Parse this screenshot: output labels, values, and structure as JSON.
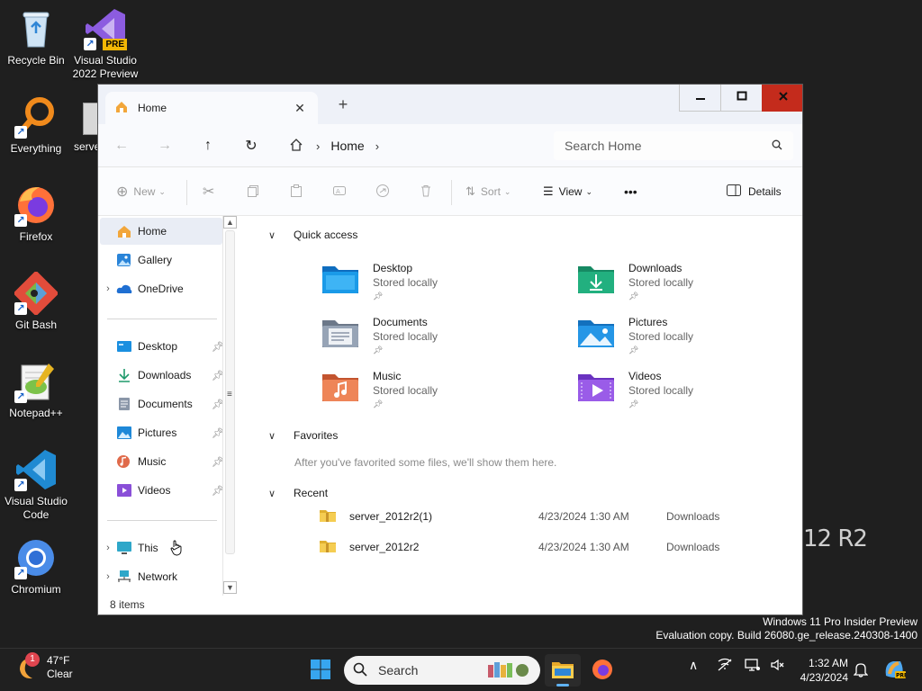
{
  "desktop": {
    "icons": [
      {
        "label": "Recycle Bin",
        "icon": "recycle-bin-icon"
      },
      {
        "label": "Visual Studio 2022 Preview",
        "icon": "visual-studio-icon",
        "badge": "PRE"
      },
      {
        "label": "Everything",
        "icon": "everything-search-icon"
      },
      {
        "label": "Firefox",
        "icon": "firefox-icon"
      },
      {
        "label": "Git Bash",
        "icon": "git-bash-icon"
      },
      {
        "label": "Notepad++",
        "icon": "notepad-plus-plus-icon"
      },
      {
        "label": "Visual Studio Code",
        "icon": "vscode-icon"
      },
      {
        "label": "Chromium",
        "icon": "chromium-icon"
      }
    ],
    "partial_icon_label": "serve",
    "background_text": "12 R2",
    "watermark": {
      "line1": "Windows 11 Pro Insider Preview",
      "line2": "Evaluation copy. Build 26080.ge_release.240308-1400"
    }
  },
  "window": {
    "tab": {
      "title": "Home",
      "icon": "home-icon"
    },
    "new_tab_label": "+",
    "controls": {
      "minimize": "minimize-icon",
      "maximize": "maximize-icon",
      "close": "close-icon"
    },
    "address": {
      "root_icon": "home-icon",
      "location": "Home"
    },
    "search": {
      "placeholder": "Search Home"
    },
    "toolbar": {
      "new_label": "New",
      "sort_label": "Sort",
      "view_label": "View",
      "more_label": "•••",
      "details_label": "Details"
    },
    "sidebar": {
      "top": [
        {
          "label": "Home",
          "icon": "home-icon",
          "selected": true
        },
        {
          "label": "Gallery",
          "icon": "gallery-icon"
        },
        {
          "label": "OneDrive",
          "icon": "onedrive-icon",
          "expandable": true
        }
      ],
      "pinned": [
        {
          "label": "Desktop",
          "icon": "desktop-folder-icon"
        },
        {
          "label": "Downloads",
          "icon": "downloads-icon"
        },
        {
          "label": "Documents",
          "icon": "documents-icon"
        },
        {
          "label": "Pictures",
          "icon": "pictures-icon"
        },
        {
          "label": "Music",
          "icon": "music-icon"
        },
        {
          "label": "Videos",
          "icon": "videos-icon"
        }
      ],
      "bottom": [
        {
          "label": "This",
          "icon": "this-pc-icon",
          "expandable": true
        },
        {
          "label": "Network",
          "icon": "network-icon",
          "expandable": true
        }
      ]
    },
    "main": {
      "quick_access": {
        "title": "Quick access",
        "folders": [
          {
            "name": "Desktop",
            "status": "Stored locally",
            "icon": "desktop-folder-icon",
            "color": "#1a8fe0"
          },
          {
            "name": "Downloads",
            "status": "Stored locally",
            "icon": "downloads-folder-icon",
            "color": "#1fa37a"
          },
          {
            "name": "Documents",
            "status": "Stored locally",
            "icon": "documents-folder-icon",
            "color": "#7f8ca0"
          },
          {
            "name": "Pictures",
            "status": "Stored locally",
            "icon": "pictures-folder-icon",
            "color": "#1e88d8"
          },
          {
            "name": "Music",
            "status": "Stored locally",
            "icon": "music-folder-icon",
            "color": "#e06a4a"
          },
          {
            "name": "Videos",
            "status": "Stored locally",
            "icon": "videos-folder-icon",
            "color": "#8a4fd8"
          }
        ]
      },
      "favorites": {
        "title": "Favorites",
        "empty_text": "After you've favorited some files, we'll show them here."
      },
      "recent": {
        "title": "Recent",
        "items": [
          {
            "name": "server_2012r2(1)",
            "date": "4/23/2024 1:30 AM",
            "location": "Downloads"
          },
          {
            "name": "server_2012r2",
            "date": "4/23/2024 1:30 AM",
            "location": "Downloads"
          }
        ]
      }
    },
    "status": "8 items"
  },
  "taskbar": {
    "weather": {
      "temp": "47°F",
      "condition": "Clear",
      "badge": "1"
    },
    "search_label": "Search",
    "clock": {
      "time": "1:32 AM",
      "date": "4/23/2024"
    }
  }
}
